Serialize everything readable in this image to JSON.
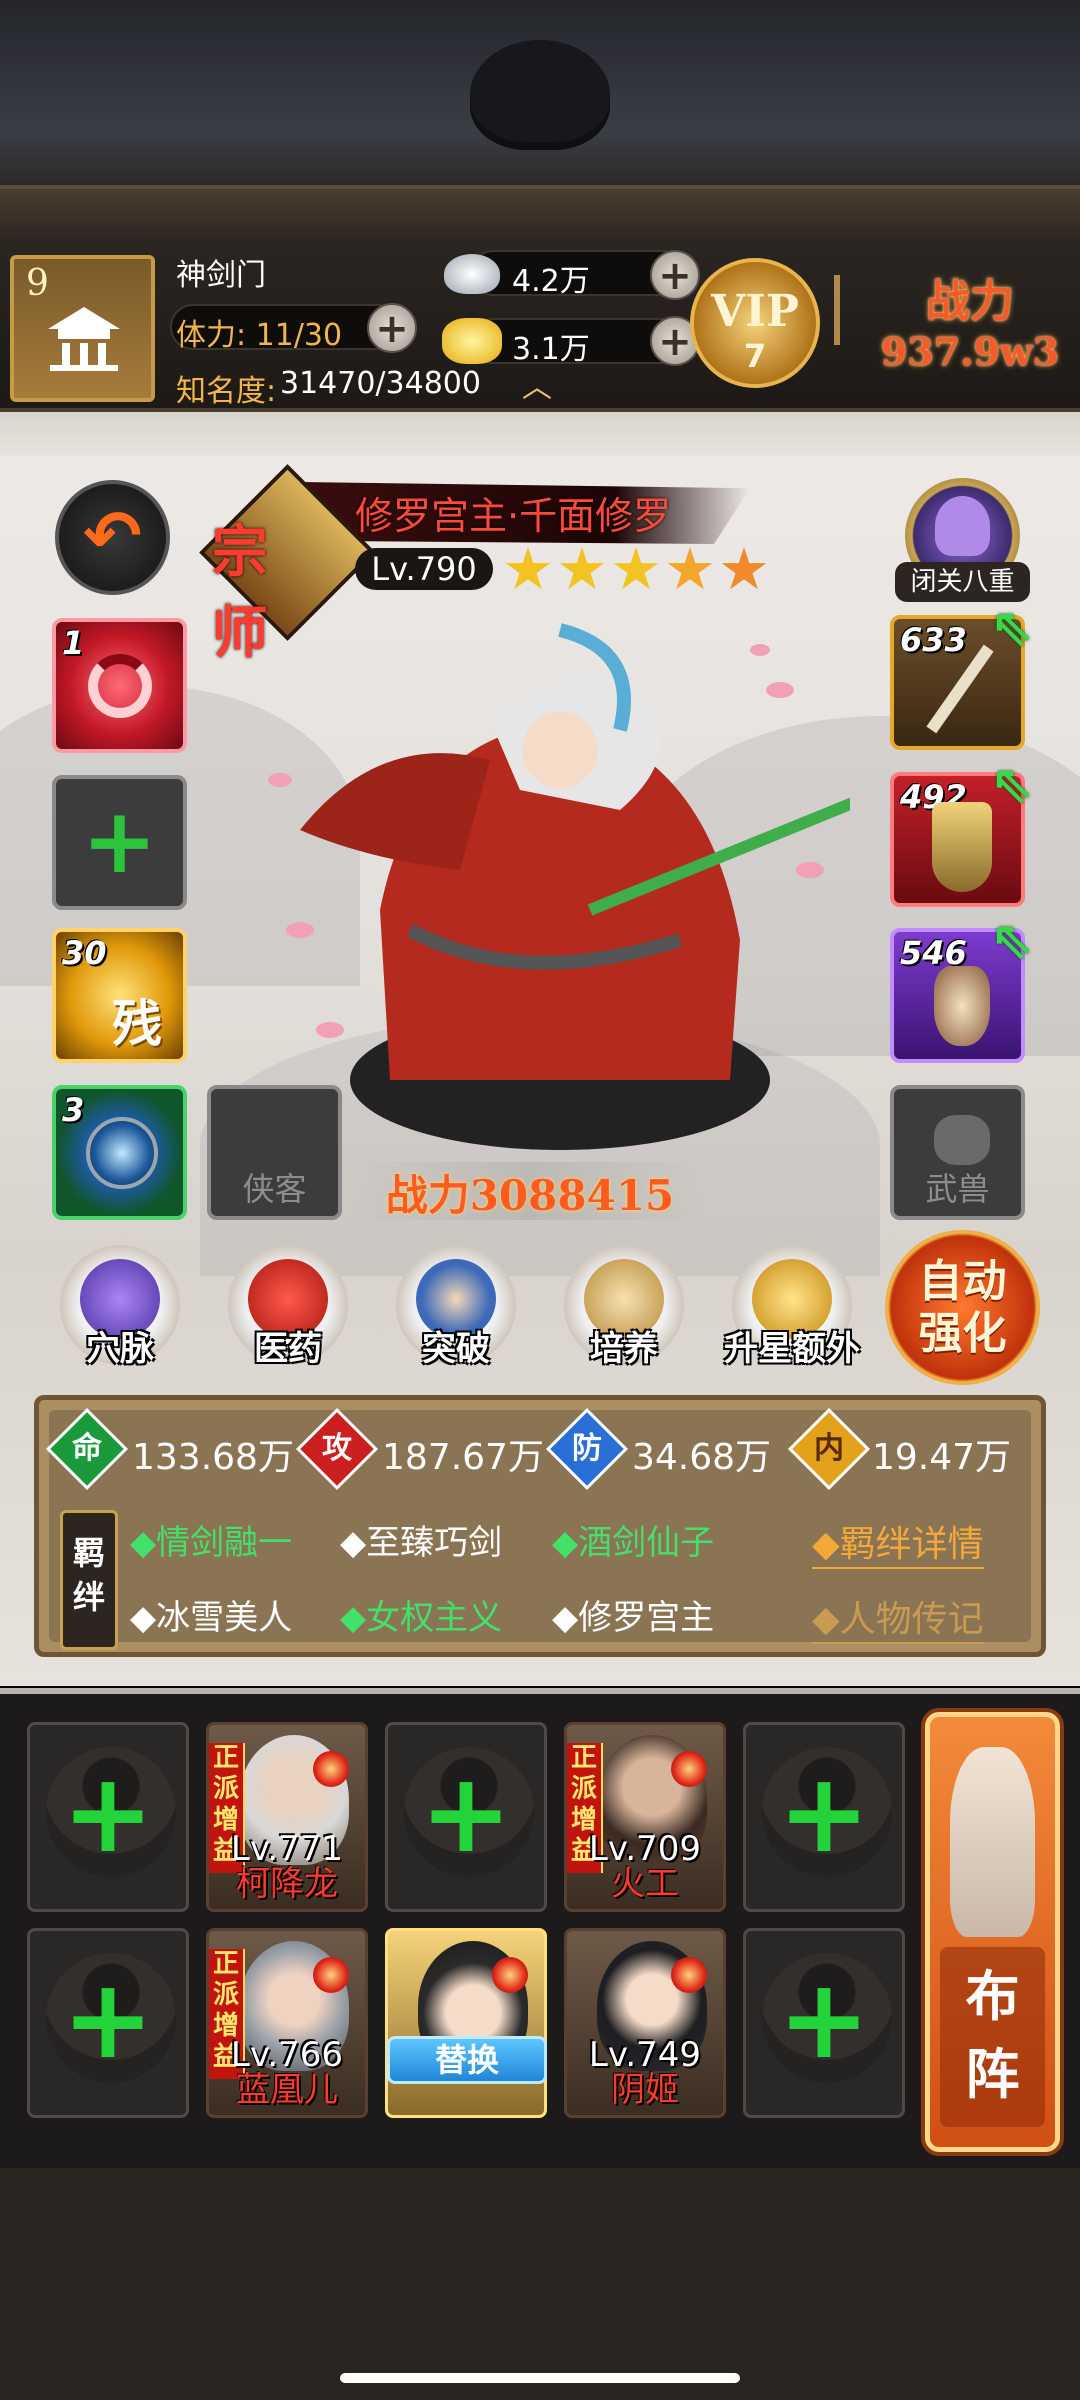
{
  "header": {
    "sect_level": "9",
    "sect_name": "神剑门",
    "stamina": "体力: 11/30",
    "fame_label": "知名度:",
    "fame_value": "31470/34800",
    "silver": "4.2万",
    "gold": "3.1万",
    "vip_label": "VIP",
    "vip_level": "7",
    "power_label": "战力",
    "power_value": "937.9w3"
  },
  "hero": {
    "badge": "宗师",
    "name": "修罗宫主·千面修罗",
    "level": "Lv.790",
    "stars": 5,
    "seclusion_label": "闭关八重",
    "combat_power": "战力3088415"
  },
  "left_slots": [
    {
      "count": "1",
      "color": "#d8232f"
    },
    {
      "count": "",
      "empty": true
    },
    {
      "count": "30",
      "color": "#e3a80f",
      "glyph": "残"
    },
    {
      "count": "3",
      "color": "#1a7a3a"
    }
  ],
  "empty_slot_labels": {
    "companion": "侠客",
    "beast": "武兽"
  },
  "equipment": [
    {
      "count": "633"
    },
    {
      "count": "492"
    },
    {
      "count": "546"
    }
  ],
  "skills": [
    "穴脉",
    "医药",
    "突破",
    "培养",
    "升星额外"
  ],
  "auto_strengthen": "自动强化",
  "stats": [
    {
      "icon": "命",
      "value": "133.68万",
      "color": "#1a9a3a"
    },
    {
      "icon": "攻",
      "value": "187.67万",
      "color": "#cc1f1f"
    },
    {
      "icon": "防",
      "value": "34.68万",
      "color": "#2a6fd6"
    },
    {
      "icon": "内",
      "value": "19.47万",
      "color": "#e3a21b"
    }
  ],
  "bonds": {
    "tag": "羁绊",
    "row1": [
      {
        "text": "◆情剑融一",
        "active": true
      },
      {
        "text": "◆至臻巧剑",
        "active": false
      },
      {
        "text": "◆酒剑仙子",
        "active": true
      }
    ],
    "row2": [
      {
        "text": "◆冰雪美人",
        "active": false
      },
      {
        "text": "◆女权主义",
        "active": true
      },
      {
        "text": "◆修罗宫主",
        "active": false
      }
    ],
    "link_details": "◆羁绊详情",
    "link_bio": "◆人物传记"
  },
  "team": {
    "buff_tag": "正派增益",
    "members": [
      {
        "level": "Lv.771",
        "name": "柯降龙"
      },
      {
        "level": "Lv.709",
        "name": "火工"
      },
      {
        "level": "Lv.766",
        "name": "蓝凰儿"
      },
      {
        "level": "Lv.749",
        "name": "阴姬"
      }
    ],
    "swap_label": "替换",
    "formation_label": "布阵"
  },
  "colors": {
    "active_bond": "#43e06a",
    "inactive_bond": "#ffffff",
    "link": "#f2a93a"
  }
}
